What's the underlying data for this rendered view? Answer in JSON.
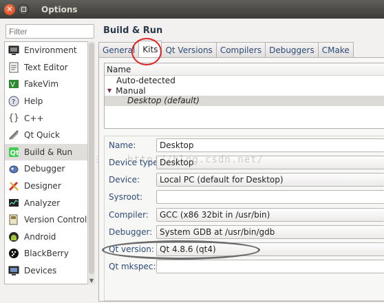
{
  "window": {
    "title": "Options"
  },
  "filter": {
    "placeholder": "Filter"
  },
  "nav": {
    "items": [
      {
        "label": "Environment",
        "icon": "monitor-icon"
      },
      {
        "label": "Text Editor",
        "icon": "text-editor-icon"
      },
      {
        "label": "FakeVim",
        "icon": "fakevim-icon"
      },
      {
        "label": "Help",
        "icon": "help-icon"
      },
      {
        "label": "C++",
        "icon": "cpp-braces-icon"
      },
      {
        "label": "Qt Quick",
        "icon": "qt-quick-icon"
      },
      {
        "label": "Build & Run",
        "icon": "build-run-icon",
        "selected": true
      },
      {
        "label": "Debugger",
        "icon": "debugger-icon"
      },
      {
        "label": "Designer",
        "icon": "designer-icon"
      },
      {
        "label": "Analyzer",
        "icon": "analyzer-icon"
      },
      {
        "label": "Version Control",
        "icon": "version-control-icon"
      },
      {
        "label": "Android",
        "icon": "android-icon"
      },
      {
        "label": "BlackBerry",
        "icon": "blackberry-icon"
      },
      {
        "label": "Devices",
        "icon": "devices-icon"
      }
    ]
  },
  "page": {
    "title": "Build & Run"
  },
  "tabs": [
    {
      "label": "General"
    },
    {
      "label": "Kits",
      "active": true
    },
    {
      "label": "Qt Versions"
    },
    {
      "label": "Compilers"
    },
    {
      "label": "Debuggers"
    },
    {
      "label": "CMake"
    }
  ],
  "kits": {
    "header": "Name",
    "auto_detected": "Auto-detected",
    "manual": "Manual",
    "desktop_default": "Desktop (default)"
  },
  "form": {
    "name": {
      "label": "Name:",
      "value": "Desktop"
    },
    "device_type": {
      "label": "Device type:",
      "value": "Desktop"
    },
    "device": {
      "label": "Device:",
      "value": "Local PC (default for Desktop)"
    },
    "sysroot": {
      "label": "Sysroot:",
      "value": ""
    },
    "compiler": {
      "label": "Compiler:",
      "value": "GCC (x86 32bit in /usr/bin)"
    },
    "debugger": {
      "label": "Debugger:",
      "value": "System GDB at /usr/bin/gdb"
    },
    "qt_version": {
      "label": "Qt version:",
      "value": "Qt 4.8.6 (qt4)"
    },
    "qt_mkspec": {
      "label": "Qt mkspec:",
      "value": ""
    }
  },
  "watermark": "http://blog.csdn.net/",
  "colors": {
    "close_button": "#e0511f",
    "annotation_red": "#e02020",
    "annotation_gray": "#6c6c6c",
    "label_blue": "#2c4a78"
  }
}
